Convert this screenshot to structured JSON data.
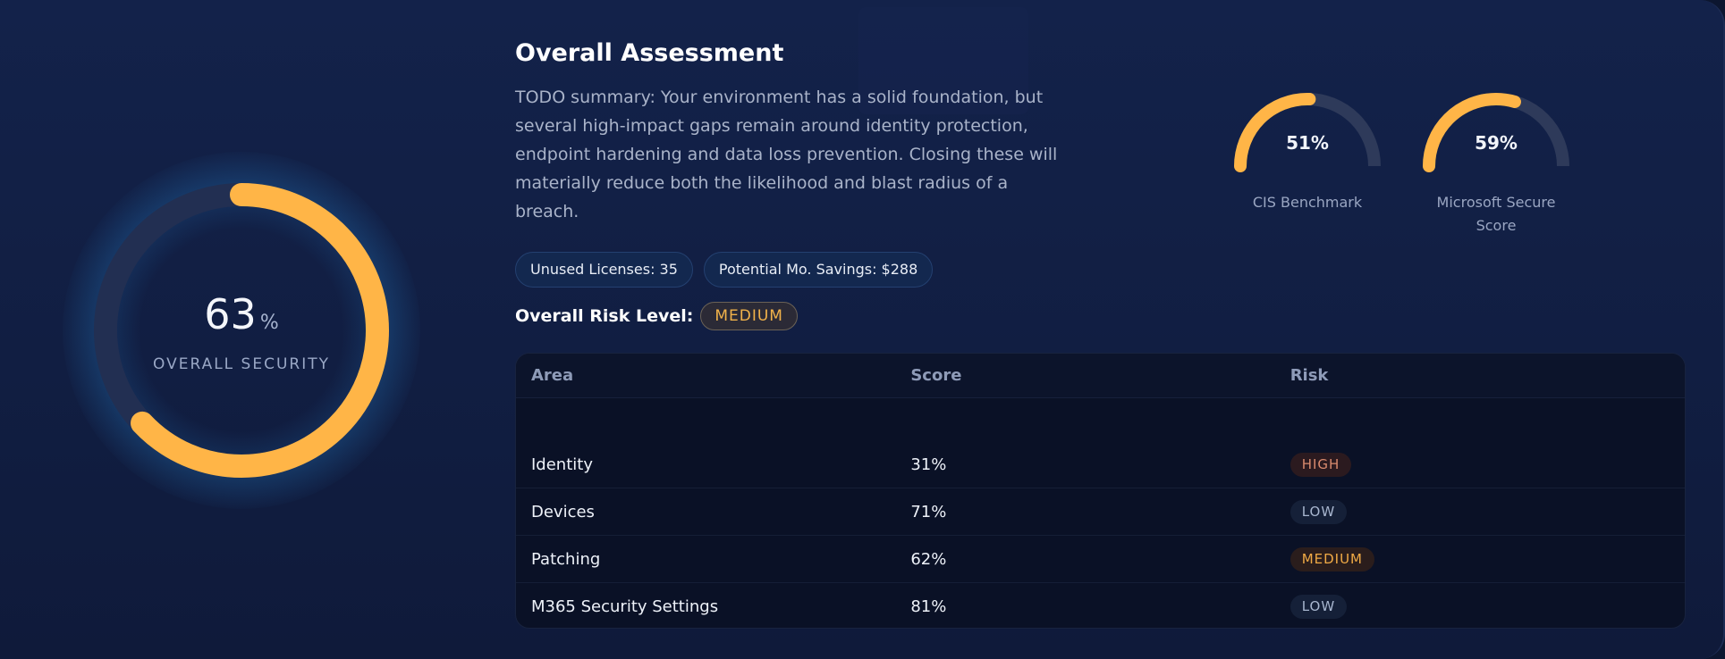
{
  "overall": {
    "value": "63",
    "unit": "%",
    "label": "OVERALL SECURITY",
    "fraction": 0.63
  },
  "assessment": {
    "title": "Overall Assessment",
    "summary": "TODO summary: Your environment has a solid foundation, but several high-impact gaps remain around identity protection, endpoint hardening and data loss prevention. Closing these will materially reduce both the likelihood and blast radius of a breach."
  },
  "gauges": [
    {
      "value": "51%",
      "fraction": 0.51,
      "label": "CIS Benchmark"
    },
    {
      "value": "59%",
      "fraction": 0.59,
      "label": "Microsoft Secure Score"
    }
  ],
  "pills": {
    "unused_licenses": "Unused Licenses: 35",
    "savings": "Potential Mo. Savings: $288"
  },
  "risk": {
    "label": "Overall Risk Level:",
    "level": "MEDIUM"
  },
  "table": {
    "headers": [
      "Area",
      "Score",
      "Risk"
    ],
    "rows": [
      {
        "area": "Identity",
        "score": "31%",
        "risk": "HIGH"
      },
      {
        "area": "Devices",
        "score": "71%",
        "risk": "LOW"
      },
      {
        "area": "Patching",
        "score": "62%",
        "risk": "MEDIUM"
      },
      {
        "area": "M365 Security Settings",
        "score": "81%",
        "risk": "LOW"
      }
    ]
  },
  "colors": {
    "accent": "#ffb547",
    "track": "#2a3657",
    "background": "#111e42"
  }
}
